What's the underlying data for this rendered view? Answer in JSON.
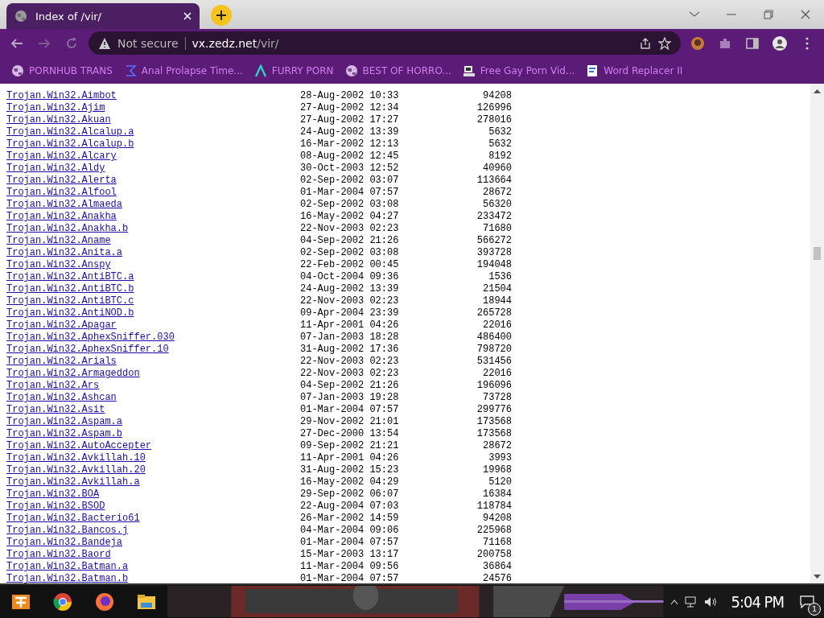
{
  "tab": {
    "title": "Index of /vir/",
    "selected": true
  },
  "toolbar": {
    "security": "Not secure",
    "url_host": "vx.zedz.net",
    "url_path": "/vir/"
  },
  "bookmarks": [
    {
      "label": "PORNHUB TRANS",
      "kind": "globe"
    },
    {
      "label": "Anal Prolapse Time...",
      "kind": "bracket"
    },
    {
      "label": "FURRY PORN",
      "kind": "lambda"
    },
    {
      "label": "BEST OF HORRO...",
      "kind": "globe"
    },
    {
      "label": "Free Gay Porn Vid...",
      "kind": "computer"
    },
    {
      "label": "Word Replacer II",
      "kind": "wr"
    }
  ],
  "listing": [
    [
      "Trojan.Win32.Aimbot",
      "28-Aug-2002 10:33",
      "94208"
    ],
    [
      "Trojan.Win32.Ajim",
      "27-Aug-2002 12:34",
      "126996"
    ],
    [
      "Trojan.Win32.Akuan",
      "27-Aug-2002 17:27",
      "278016"
    ],
    [
      "Trojan.Win32.Alcalup.a",
      "24-Aug-2002 13:39",
      "5632"
    ],
    [
      "Trojan.Win32.Alcalup.b",
      "16-Mar-2002 12:13",
      "5632"
    ],
    [
      "Trojan.Win32.Alcary",
      "08-Aug-2002 12:45",
      "8192"
    ],
    [
      "Trojan.Win32.Aldy",
      "30-Oct-2003 12:52",
      "40960"
    ],
    [
      "Trojan.Win32.Alerta",
      "02-Sep-2002 03:07",
      "113664"
    ],
    [
      "Trojan.Win32.Alfool",
      "01-Mar-2004 07:57",
      "28672"
    ],
    [
      "Trojan.Win32.Almaeda",
      "02-Sep-2002 03:08",
      "56320"
    ],
    [
      "Trojan.Win32.Anakha",
      "16-May-2002 04:27",
      "233472"
    ],
    [
      "Trojan.Win32.Anakha.b",
      "22-Nov-2003 02:23",
      "71680"
    ],
    [
      "Trojan.Win32.Aname",
      "04-Sep-2002 21:26",
      "566272"
    ],
    [
      "Trojan.Win32.Anita.a",
      "02-Sep-2002 03:08",
      "393728"
    ],
    [
      "Trojan.Win32.Anspy",
      "22-Feb-2002 00:45",
      "194048"
    ],
    [
      "Trojan.Win32.AntiBTC.a",
      "04-Oct-2004 09:36",
      "1536"
    ],
    [
      "Trojan.Win32.AntiBTC.b",
      "24-Aug-2002 13:39",
      "21504"
    ],
    [
      "Trojan.Win32.AntiBTC.c",
      "22-Nov-2003 02:23",
      "18944"
    ],
    [
      "Trojan.Win32.AntiNOD.b",
      "09-Apr-2004 23:39",
      "265728"
    ],
    [
      "Trojan.Win32.Apagar",
      "11-Apr-2001 04:26",
      "22016"
    ],
    [
      "Trojan.Win32.AphexSniffer.030",
      "07-Jan-2003 18:28",
      "486400"
    ],
    [
      "Trojan.Win32.AphexSniffer.10",
      "31-Aug-2002 17:36",
      "798720"
    ],
    [
      "Trojan.Win32.Arials",
      "22-Nov-2003 02:23",
      "531456"
    ],
    [
      "Trojan.Win32.Armageddon",
      "22-Nov-2003 02:23",
      "22016"
    ],
    [
      "Trojan.Win32.Ars",
      "04-Sep-2002 21:26",
      "196096"
    ],
    [
      "Trojan.Win32.Ashcan",
      "07-Jan-2003 19:28",
      "73728"
    ],
    [
      "Trojan.Win32.Asit",
      "01-Mar-2004 07:57",
      "299776"
    ],
    [
      "Trojan.Win32.Aspam.a",
      "29-Nov-2002 21:01",
      "173568"
    ],
    [
      "Trojan.Win32.Aspam.b",
      "27-Dec-2000 13:54",
      "173568"
    ],
    [
      "Trojan.Win32.AutoAccepter",
      "09-Sep-2002 21:21",
      "28672"
    ],
    [
      "Trojan.Win32.Avkillah.10",
      "11-Apr-2001 04:26",
      "3993"
    ],
    [
      "Trojan.Win32.Avkillah.20",
      "31-Aug-2002 15:23",
      "19968"
    ],
    [
      "Trojan.Win32.Avkillah.a",
      "16-May-2002 04:29",
      "5120"
    ],
    [
      "Trojan.Win32.BOA",
      "29-Sep-2002 06:07",
      "16384"
    ],
    [
      "Trojan.Win32.BSOD",
      "22-Aug-2004 07:03",
      "118784"
    ],
    [
      "Trojan.Win32.Bacterio61",
      "26-Mar-2002 14:59",
      "94208"
    ],
    [
      "Trojan.Win32.Bancos.j",
      "04-Mar-2004 09:06",
      "225968"
    ],
    [
      "Trojan.Win32.Bandeja",
      "01-Mar-2004 07:57",
      "71168"
    ],
    [
      "Trojan.Win32.Baord",
      "15-Mar-2003 13:17",
      "200758"
    ],
    [
      "Trojan.Win32.Batman.a",
      "11-Mar-2004 09:56",
      "36864"
    ],
    [
      "Trojan.Win32.Batman.b",
      "01-Mar-2004 07:57",
      "24576"
    ]
  ],
  "taskbar": {
    "clock": "5:04 PM",
    "notification_count": "1"
  }
}
